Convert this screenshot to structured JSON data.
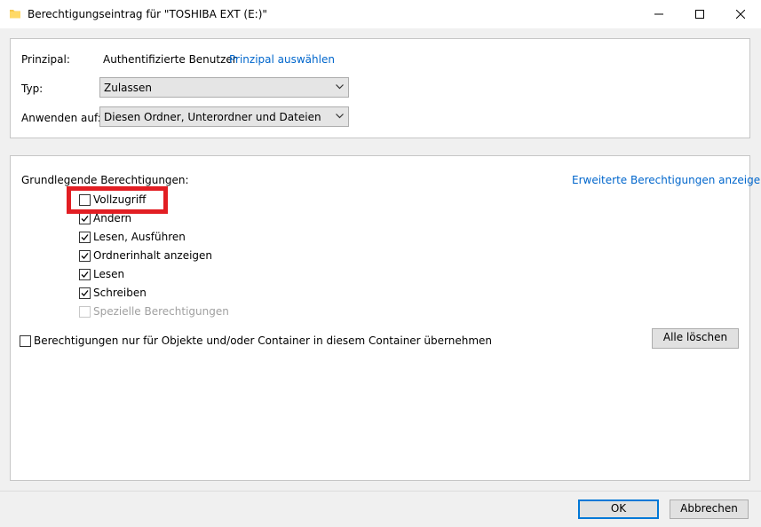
{
  "window": {
    "title": "Berechtigungseintrag für \"TOSHIBA EXT (E:)\"",
    "icons": [
      "folder-icon",
      "minimize-icon",
      "maximize-icon",
      "close-icon"
    ]
  },
  "principal": {
    "label": "Prinzipal:",
    "value": "Authentifizierte Benutzer",
    "select_link": "Prinzipal auswählen"
  },
  "type": {
    "label": "Typ:",
    "selected": "Zulassen"
  },
  "apply_to": {
    "label": "Anwenden auf:",
    "selected": "Diesen Ordner, Unterordner und Dateien"
  },
  "permissions": {
    "heading": "Grundlegende Berechtigungen:",
    "advanced_link": "Erweiterte Berechtigungen anzeigen",
    "items": [
      {
        "label": "Vollzugriff",
        "checked": false,
        "enabled": true
      },
      {
        "label": "Ändern",
        "checked": true,
        "enabled": true
      },
      {
        "label": "Lesen, Ausführen",
        "checked": true,
        "enabled": true
      },
      {
        "label": "Ordnerinhalt anzeigen",
        "checked": true,
        "enabled": true
      },
      {
        "label": "Lesen",
        "checked": true,
        "enabled": true
      },
      {
        "label": "Schreiben",
        "checked": true,
        "enabled": true
      },
      {
        "label": "Spezielle Berechtigungen",
        "checked": false,
        "enabled": false
      }
    ],
    "inherit_only": {
      "label": "Berechtigungen nur für Objekte und/oder Container in diesem Container übernehmen",
      "checked": false
    },
    "clear_all": "Alle löschen"
  },
  "buttons": {
    "ok": "OK",
    "cancel": "Abbrechen"
  },
  "colors": {
    "highlight": "#e21e23",
    "link": "#0066cc",
    "default_button_border": "#0078d7"
  }
}
